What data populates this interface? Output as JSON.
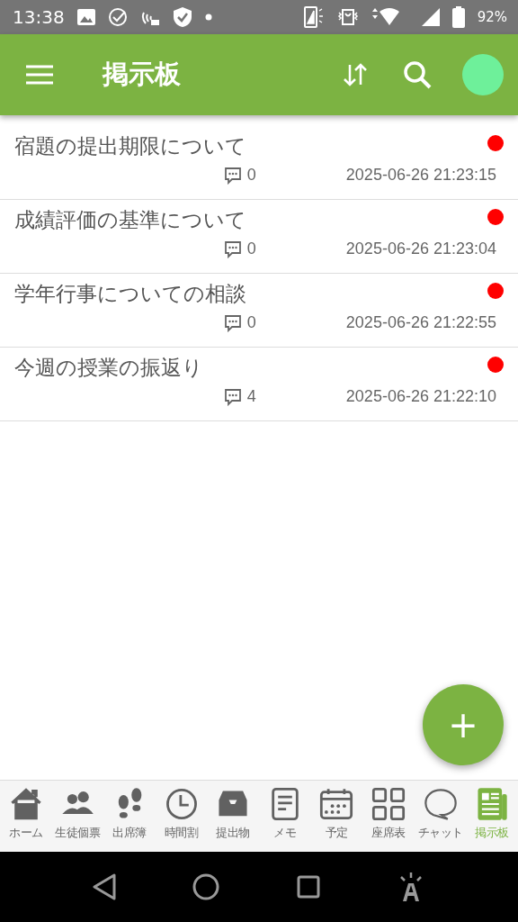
{
  "status_bar": {
    "time": "13:38",
    "battery": "92%"
  },
  "app_bar": {
    "title": "掲示板"
  },
  "posts": [
    {
      "title": "宿題の提出期限について",
      "comments": "0",
      "timestamp": "2025-06-26 21:23:15",
      "unread": true
    },
    {
      "title": "成績評価の基準について",
      "comments": "0",
      "timestamp": "2025-06-26 21:23:04",
      "unread": true
    },
    {
      "title": "学年行事についての相談",
      "comments": "0",
      "timestamp": "2025-06-26 21:22:55",
      "unread": true
    },
    {
      "title": "今週の授業の振返り",
      "comments": "4",
      "timestamp": "2025-06-26 21:22:10",
      "unread": true
    }
  ],
  "fab": {
    "label": "+"
  },
  "bottom_nav": [
    {
      "label": "ホーム",
      "selected": false
    },
    {
      "label": "生徒個票",
      "selected": false
    },
    {
      "label": "出席簿",
      "selected": false
    },
    {
      "label": "時間割",
      "selected": false
    },
    {
      "label": "提出物",
      "selected": false
    },
    {
      "label": "メモ",
      "selected": false
    },
    {
      "label": "予定",
      "selected": false
    },
    {
      "label": "座席表",
      "selected": false
    },
    {
      "label": "チャット",
      "selected": false
    },
    {
      "label": "掲示板",
      "selected": true
    }
  ]
}
